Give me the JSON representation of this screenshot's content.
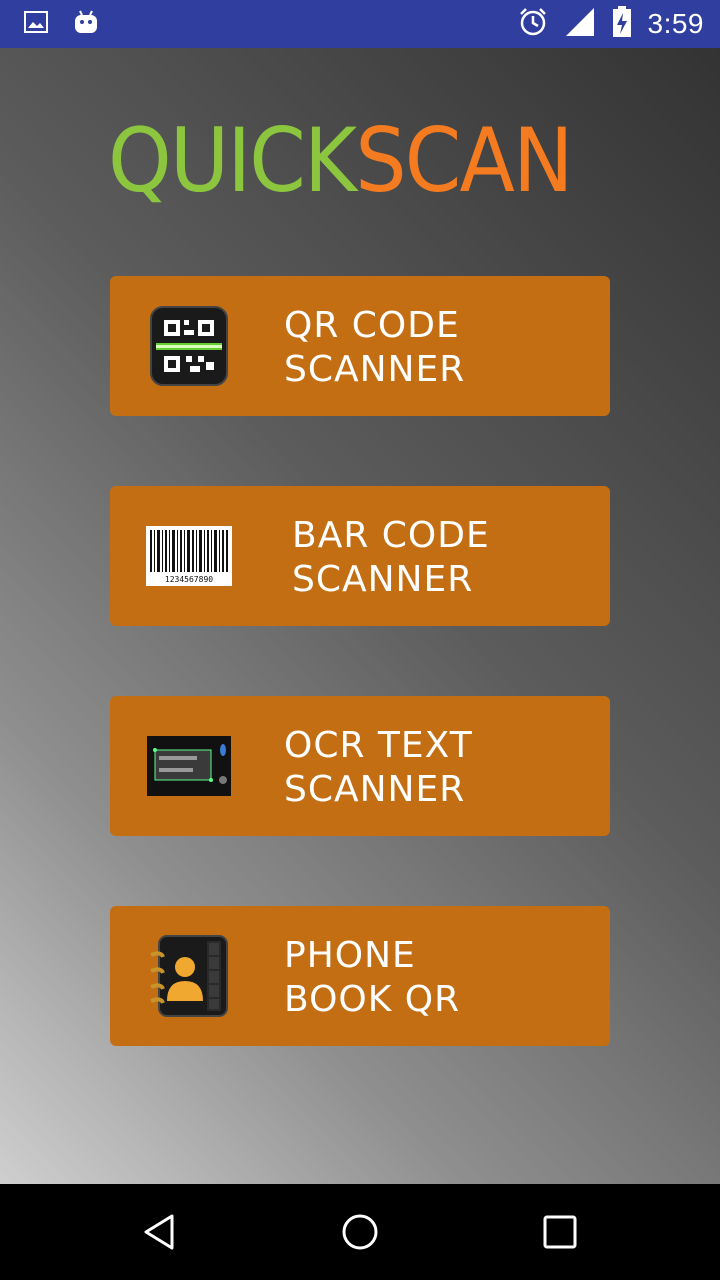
{
  "status_bar": {
    "time": "3:59",
    "left_icons": [
      "image-icon",
      "android-icon"
    ],
    "right_icons": [
      "alarm-icon",
      "signal-icon",
      "battery-icon"
    ]
  },
  "logo": {
    "part1": "QUICK",
    "part2": "SCAN"
  },
  "menu": [
    {
      "id": "qr",
      "label": "QR CODE\nSCANNER",
      "icon": "qr-code-icon"
    },
    {
      "id": "barcode",
      "label": "BAR CODE\nSCANNER",
      "icon": "barcode-icon"
    },
    {
      "id": "ocr",
      "label": "OCR TEXT\nSCANNER",
      "icon": "ocr-text-icon"
    },
    {
      "id": "phonebook",
      "label": "PHONE\nBOOK QR",
      "icon": "phone-book-icon"
    }
  ],
  "barcode_digits": "1234567890",
  "nav": [
    "back-icon",
    "home-icon",
    "recents-icon"
  ],
  "colors": {
    "status_bar": "#303F9F",
    "logo_green": "#8CC63F",
    "logo_orange": "#F47B20",
    "button": "#C46E14"
  }
}
